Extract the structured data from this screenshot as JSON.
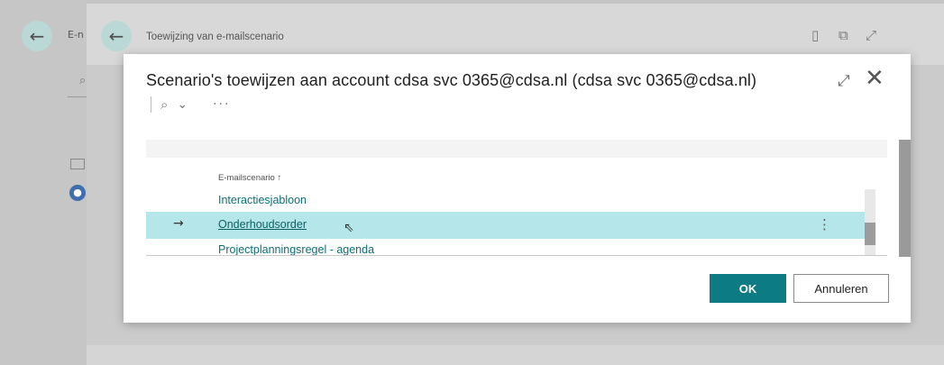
{
  "background": {
    "page1_title": "E-n",
    "page2_title": "Toewijzing van e-mailscenario"
  },
  "dialog": {
    "title": "Scenario's toewijzen aan account cdsa svc 0365@cdsa.nl (cdsa svc 0365@cdsa.nl)",
    "toolbar_more": "···",
    "column_header": "E-mailscenario ↑",
    "rows": [
      {
        "label": "Interactiesjabloon"
      },
      {
        "label": "Onderhoudsorder"
      },
      {
        "label": "Projectplanningsregel - agenda"
      }
    ],
    "ok_label": "OK",
    "cancel_label": "Annuleren"
  },
  "colors": {
    "accent": "#0d7b83",
    "selected_row": "#b5e6ea",
    "link": "#0e6f74"
  },
  "icons": [
    "back-arrow-icon",
    "search-icon",
    "chevron-down-icon",
    "bookmark-icon",
    "open-new-icon",
    "expand-icon",
    "close-icon",
    "row-arrow-icon",
    "more-vertical-icon",
    "cursor-icon",
    "mail-icon",
    "avatar-icon"
  ]
}
